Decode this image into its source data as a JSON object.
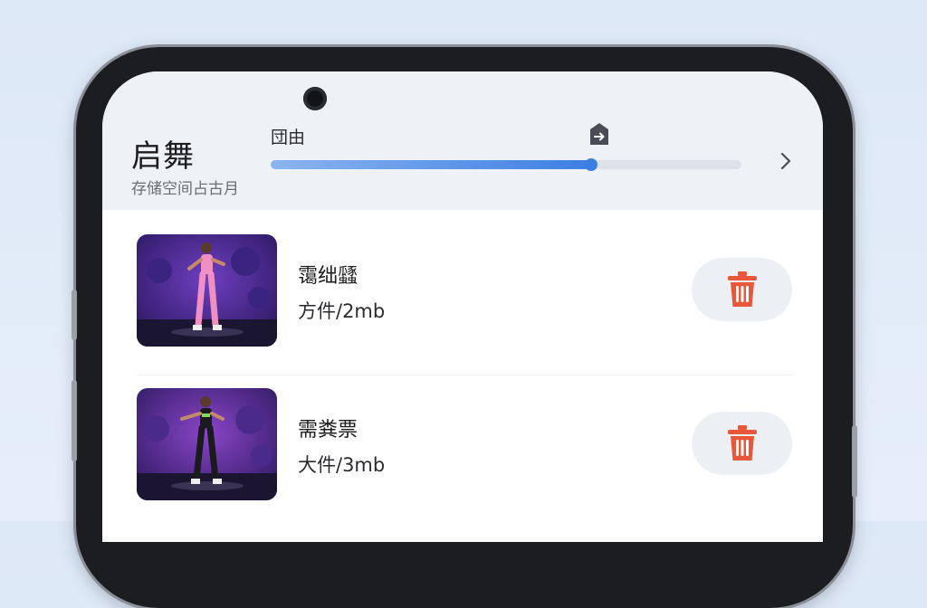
{
  "app": {
    "title": "启舞",
    "storage_label": "存储空间占古月"
  },
  "storage_bar": {
    "label": "団由",
    "progress_fraction": 0.68,
    "marker_icon": "arrow-tag-icon",
    "chevron_icon": "chevron-right-icon"
  },
  "items": [
    {
      "title": "霭绌瓥",
      "size": "方件/2mb",
      "outfit_color": "#f08fc4",
      "delete_icon": "trash-icon"
    },
    {
      "title": "需粪票",
      "size": "大件/3mb",
      "outfit_color": "#1b1b1d",
      "delete_icon": "trash-icon"
    }
  ],
  "colors": {
    "accent": "#3c7fe3",
    "delete": "#e8573a",
    "page_bg": "#dde8f7"
  }
}
